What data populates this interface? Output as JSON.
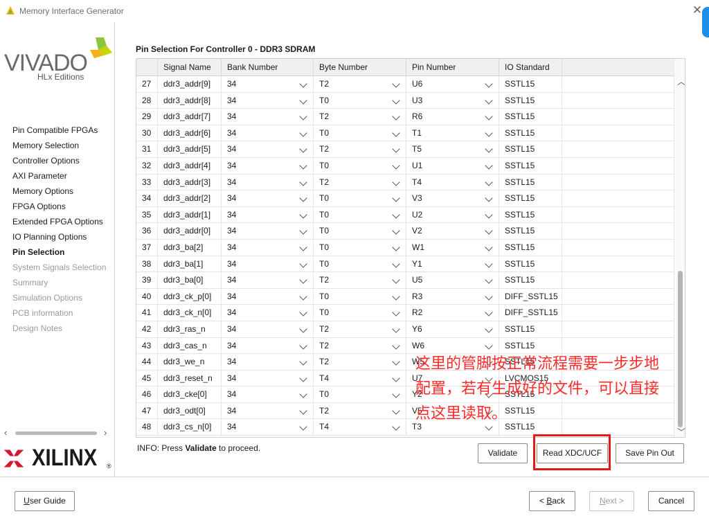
{
  "window": {
    "title": "Memory Interface Generator",
    "close_glyph": "✕",
    "accent_color": "#1e8fe6"
  },
  "branding": {
    "vivado": "VIVADO",
    "hlx": "HLx Editions",
    "xilinx": "XILINX",
    "registered": "®"
  },
  "nav": {
    "items": [
      {
        "label": "Pin Compatible FPGAs",
        "state": "normal"
      },
      {
        "label": "Memory Selection",
        "state": "normal"
      },
      {
        "label": "Controller Options",
        "state": "normal"
      },
      {
        "label": "AXI Parameter",
        "state": "normal"
      },
      {
        "label": "Memory Options",
        "state": "normal"
      },
      {
        "label": "FPGA Options",
        "state": "normal"
      },
      {
        "label": "Extended FPGA Options",
        "state": "normal"
      },
      {
        "label": "IO Planning Options",
        "state": "normal"
      },
      {
        "label": "Pin Selection",
        "state": "active"
      },
      {
        "label": "System Signals Selection",
        "state": "disabled"
      },
      {
        "label": "Summary",
        "state": "disabled"
      },
      {
        "label": "Simulation Options",
        "state": "disabled"
      },
      {
        "label": "PCB information",
        "state": "disabled"
      },
      {
        "label": "Design Notes",
        "state": "disabled"
      }
    ]
  },
  "main": {
    "section_title": "Pin Selection For Controller 0 - DDR3 SDRAM",
    "columns": [
      "",
      "Signal Name",
      "Bank Number",
      "Byte Number",
      "Pin Number",
      "IO Standard"
    ],
    "rows": [
      [
        "27",
        "ddr3_addr[9]",
        "34",
        "T2",
        "U6",
        "SSTL15"
      ],
      [
        "28",
        "ddr3_addr[8]",
        "34",
        "T0",
        "U3",
        "SSTL15"
      ],
      [
        "29",
        "ddr3_addr[7]",
        "34",
        "T2",
        "R6",
        "SSTL15"
      ],
      [
        "30",
        "ddr3_addr[6]",
        "34",
        "T0",
        "T1",
        "SSTL15"
      ],
      [
        "31",
        "ddr3_addr[5]",
        "34",
        "T2",
        "T5",
        "SSTL15"
      ],
      [
        "32",
        "ddr3_addr[4]",
        "34",
        "T0",
        "U1",
        "SSTL15"
      ],
      [
        "33",
        "ddr3_addr[3]",
        "34",
        "T2",
        "T4",
        "SSTL15"
      ],
      [
        "34",
        "ddr3_addr[2]",
        "34",
        "T0",
        "V3",
        "SSTL15"
      ],
      [
        "35",
        "ddr3_addr[1]",
        "34",
        "T0",
        "U2",
        "SSTL15"
      ],
      [
        "36",
        "ddr3_addr[0]",
        "34",
        "T0",
        "V2",
        "SSTL15"
      ],
      [
        "37",
        "ddr3_ba[2]",
        "34",
        "T0",
        "W1",
        "SSTL15"
      ],
      [
        "38",
        "ddr3_ba[1]",
        "34",
        "T0",
        "Y1",
        "SSTL15"
      ],
      [
        "39",
        "ddr3_ba[0]",
        "34",
        "T2",
        "U5",
        "SSTL15"
      ],
      [
        "40",
        "ddr3_ck_p[0]",
        "34",
        "T0",
        "R3",
        "DIFF_SSTL15"
      ],
      [
        "41",
        "ddr3_ck_n[0]",
        "34",
        "T0",
        "R2",
        "DIFF_SSTL15"
      ],
      [
        "42",
        "ddr3_ras_n",
        "34",
        "T2",
        "Y6",
        "SSTL15"
      ],
      [
        "43",
        "ddr3_cas_n",
        "34",
        "T2",
        "W6",
        "SSTL15"
      ],
      [
        "44",
        "ddr3_we_n",
        "34",
        "T2",
        "W5",
        "SSTL15"
      ],
      [
        "45",
        "ddr3_reset_n",
        "34",
        "T4",
        "U7",
        "LVCMOS15"
      ],
      [
        "46",
        "ddr3_cke[0]",
        "34",
        "T0",
        "Y2",
        "SSTL15"
      ],
      [
        "47",
        "ddr3_odt[0]",
        "34",
        "T2",
        "V5",
        "SSTL15"
      ],
      [
        "48",
        "ddr3_cs_n[0]",
        "34",
        "T4",
        "T3",
        "SSTL15"
      ]
    ],
    "info_prefix": "INFO: Press ",
    "info_bold": "Validate",
    "info_suffix": " to proceed.",
    "buttons": {
      "validate": "Validate",
      "read_xdc": "Read XDC/UCF",
      "save_pin_out": "Save Pin Out"
    },
    "annotation": "这里的管脚按正常流程需要一步步地配置，若有生成好的文件，可以直接点这里读取。",
    "annotation_color": "#ff2a2a",
    "highlight_color": "#e41a1a"
  },
  "footer": {
    "user_guide": "User Guide",
    "back": "< Back",
    "next": "Next >",
    "cancel": "Cancel"
  }
}
